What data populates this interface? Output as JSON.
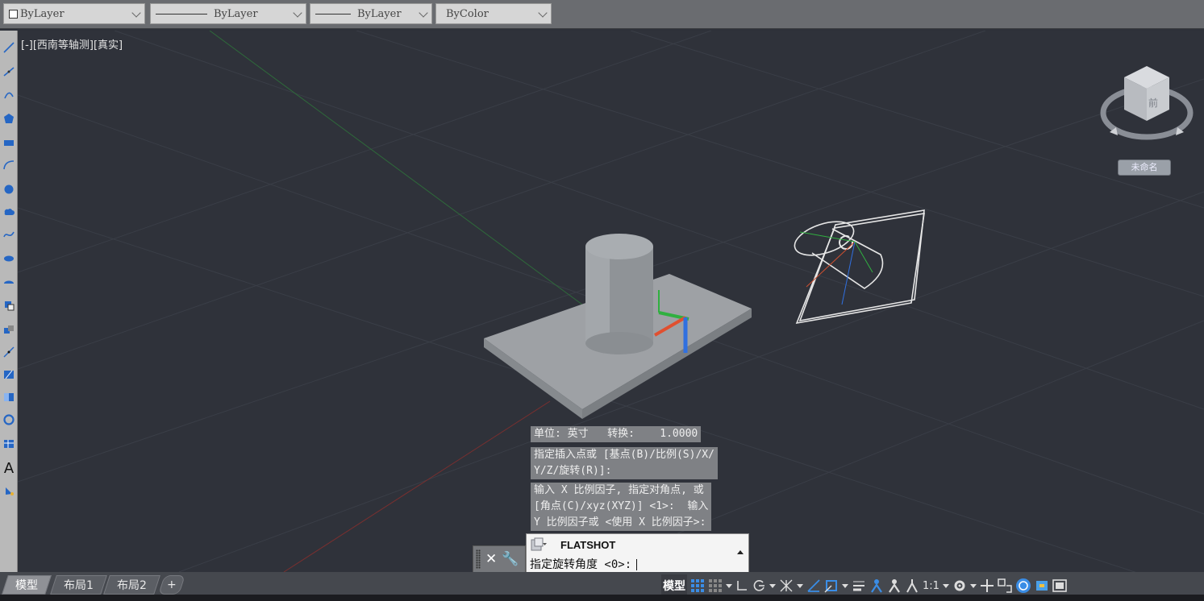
{
  "properties_bar": {
    "layer_color": "ByLayer",
    "linetype": "ByLayer",
    "lineweight": "ByLayer",
    "plot_style": "ByColor"
  },
  "viewport": {
    "label": "[-][西南等轴测][真实]"
  },
  "viewcube": {
    "face_label": "前",
    "ucs_name": "未命名"
  },
  "command_history": [
    "单位: 英寸   转换:    1.0000",
    "指定插入点或 [基点(B)/比例(S)/X/\nY/Z/旋转(R)]:",
    "输入 X 比例因子, 指定对角点, 或\n[角点(C)/xyz(XYZ)] <1>:  输入\nY 比例因子或 <使用 X 比例因子>:"
  ],
  "command_line": {
    "command_name": "FLATSHOT",
    "prompt": "指定旋转角度 <0>:"
  },
  "layout_tabs": [
    "模型",
    "布局1",
    "布局2"
  ],
  "status_bar": {
    "model_label": "模型",
    "annotation_scale": "1:1"
  },
  "colors": {
    "viewport_bg": "#2f323a",
    "axis_x": "#e05030",
    "axis_y": "#30b040",
    "axis_z": "#3070e0",
    "accent": "#3a8de6"
  }
}
